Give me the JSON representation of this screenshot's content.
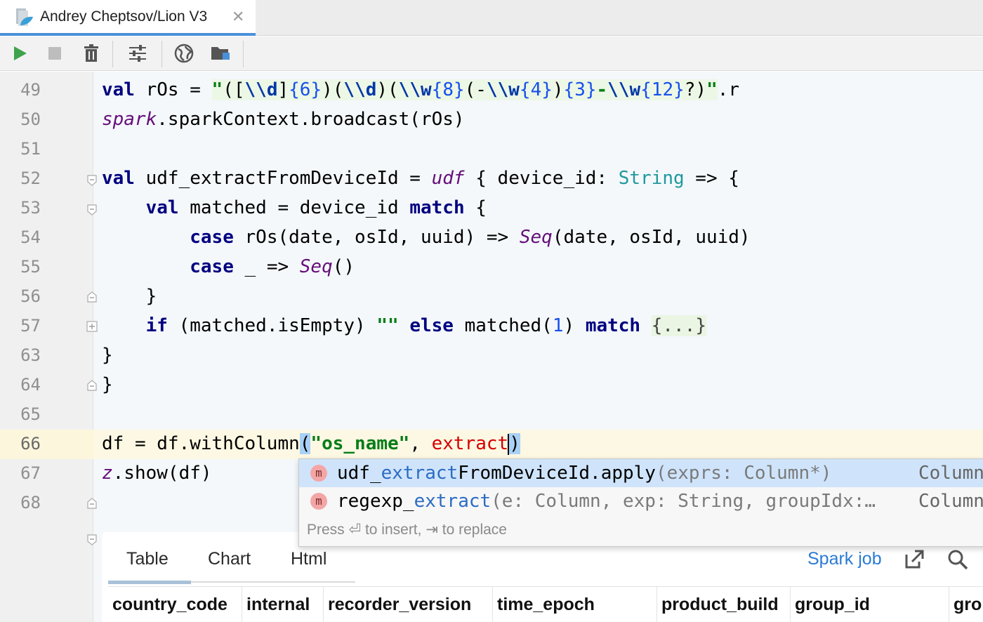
{
  "tab": {
    "title": "Andrey Cheptsov/Lion V3",
    "close": "✕",
    "icon": "notebook-icon"
  },
  "toolbar": {
    "buttons": [
      "run-icon",
      "stop-icon",
      "clear-output-icon",
      "settings-icon",
      "web-icon",
      "project-folder-icon"
    ]
  },
  "editor": {
    "line_numbers": [
      "49",
      "50",
      "51",
      "52",
      "53",
      "54",
      "55",
      "56",
      "57",
      "63",
      "64",
      "65",
      "66",
      "67",
      "68"
    ],
    "current_line": "66",
    "lines": {
      "l49": {
        "kw_val": "val",
        "name": " rOs = ",
        "q1": "\"",
        "p1": "([",
        "e1": "\\\\d",
        "p2": "]",
        "n1": "{6}",
        "p3": ")(",
        "e2": "\\\\d",
        "p4": ")(",
        "e3": "\\\\w",
        "n2": "{8}",
        "p5": "(-",
        "e4": "\\\\w",
        "n3": "{4}",
        "p6": ")",
        "n4": "{3}",
        "p7": "-",
        "e5": "\\\\w",
        "n5": "{12}",
        "p8": "?)",
        "q2": "\"",
        "tail": ".r"
      },
      "l50": {
        "spark": "spark",
        "rest": ".sparkContext.broadcast(rOs)"
      },
      "l52": {
        "kw_val": "val",
        "a": " udf_extractFromDeviceId = ",
        "udf": "udf",
        "b": " { device_id: ",
        "type": "String",
        "c": " => {"
      },
      "l53": {
        "indent": "    ",
        "kw_val": "val",
        "a": " matched = device_id ",
        "kw_match": "match",
        "b": " {"
      },
      "l54": {
        "indent": "        ",
        "kw_case": "case",
        "a": " rOs(date, osId, uuid) => ",
        "seq": "Seq",
        "b": "(date, osId, uuid)"
      },
      "l55": {
        "indent": "        ",
        "kw_case": "case",
        "a": " _ => ",
        "seq": "Seq",
        "b": "()"
      },
      "l56": {
        "text": "    }"
      },
      "l57": {
        "indent": "    ",
        "kw_if": "if",
        "a": " (matched.isEmpty) ",
        "str": "\"\"",
        "kw_else": " else",
        "b": " matched(",
        "num": "1",
        "c": ") ",
        "kw_match": "match",
        "d": " ",
        "folded": "{...}"
      },
      "l63": {
        "text": "}"
      },
      "l64": {
        "text": "}"
      },
      "l66": {
        "a": "df = df.withColumn",
        "paren": "(",
        "str": "\"os_name\"",
        "b": ", ",
        "typed": "extract",
        "close": ")"
      },
      "l67": {
        "z": "z",
        "rest": ".show(df)"
      }
    }
  },
  "completion": {
    "items": [
      {
        "icon": "m",
        "pre": "udf_",
        "match": "extract",
        "post": "FromDeviceId.apply",
        "signature": "(exprs: Column*)",
        "type": "Column"
      },
      {
        "icon": "m",
        "pre": "regexp_",
        "match": "extract",
        "post": "",
        "signature": "(e: Column, exp: String, groupIdx:…",
        "type": "Column"
      }
    ],
    "hint": "Press ⏎ to insert, ⇥ to replace",
    "more": "⋮"
  },
  "output": {
    "tabs": [
      "Table",
      "Chart",
      "Html"
    ],
    "active_tab": "Table",
    "spark_job": "Spark job",
    "columns": [
      "country_code",
      "internal",
      "recorder_version",
      "time_epoch",
      "product_build",
      "group_id",
      "gro"
    ]
  }
}
